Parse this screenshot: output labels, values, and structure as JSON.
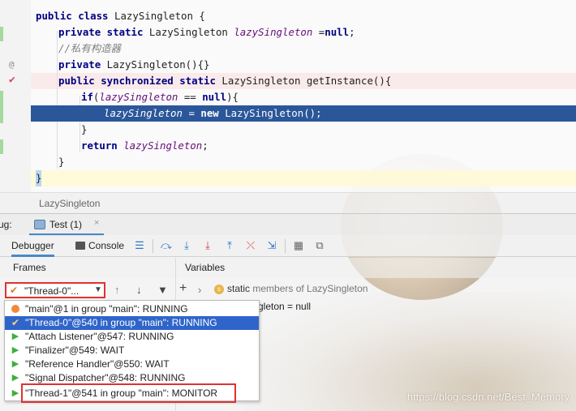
{
  "editor": {
    "lines": {
      "l1": {
        "kw1": "public class",
        "name": " LazySingleton {"
      },
      "l2": {
        "kw": "private static",
        "type": " LazySingleton ",
        "field": "lazySingleton",
        "rest": " =",
        "kw2": "null",
        "end": ";"
      },
      "l3": {
        "comment": "//私有构造器"
      },
      "l4": {
        "kw": "private",
        "rest": " LazySingleton(){}"
      },
      "l5": {
        "kw": "public synchronized static",
        "rest": " LazySingleton getInstance(){"
      },
      "l6": {
        "kw": "if",
        "open": "(",
        "field": "lazySingleton",
        "mid": " == ",
        "kw2": "null",
        "end": "){"
      },
      "l7": {
        "field": "lazySingleton",
        "mid": " = ",
        "kw": "new",
        "rest": " LazySingleton();"
      },
      "l8": {
        "text": "}"
      },
      "l9": {
        "kw": "return",
        "field": " lazySingleton",
        "end": ";"
      },
      "l10": {
        "text": "}"
      },
      "l11": {
        "text": "}"
      }
    }
  },
  "breadcrumb": {
    "text": "LazySingleton"
  },
  "debug": {
    "label": "ug:",
    "tab_label": "Test (1)",
    "tab_close": "×"
  },
  "toolbar": {
    "debugger_tab": "Debugger",
    "console_tab": "Console"
  },
  "panels": {
    "frames": "Frames",
    "variables": "Variables"
  },
  "frames": {
    "selected_thread": "\"Thread-0\"...",
    "threads": [
      {
        "label": "\"main\"@1 in group \"main\": RUNNING",
        "icon": "orange-dot"
      },
      {
        "label": "\"Thread-0\"@540 in group \"main\": RUNNING",
        "icon": "check"
      },
      {
        "label": "\"Attach Listener\"@547: RUNNING",
        "icon": "play"
      },
      {
        "label": "\"Finalizer\"@549: WAIT",
        "icon": "play"
      },
      {
        "label": "\"Reference Handler\"@550: WAIT",
        "icon": "play"
      },
      {
        "label": "\"Signal Dispatcher\"@548: RUNNING",
        "icon": "play"
      },
      {
        "label": "\"Thread-1\"@541 in group \"main\": MONITOR",
        "icon": "play"
      }
    ]
  },
  "variables": {
    "static_prefix": "static",
    "static_rest": " members of LazySingleton",
    "value_line": "gleton = null"
  },
  "watermark": "https://blog.csdn.net/Best_Memory",
  "colors": {
    "selection": "#2b579a",
    "highlight_box": "#e03131",
    "accent": "#4a88c7"
  }
}
